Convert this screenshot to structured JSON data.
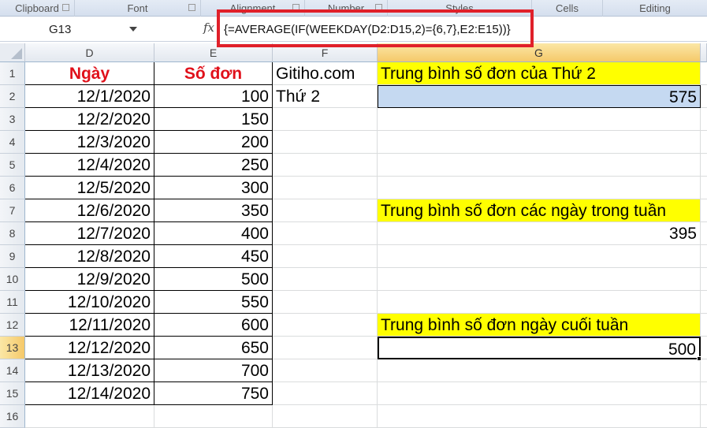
{
  "ribbon_groups": [
    "Clipboard",
    "Font",
    "Alignment",
    "Number",
    "Styles",
    "Cells",
    "Editing"
  ],
  "name_box": "G13",
  "formula": "{=AVERAGE(IF(WEEKDAY(D2:D15,2)={6,7},E2:E15))}",
  "columns": [
    "D",
    "E",
    "F",
    "G"
  ],
  "rows": [
    "1",
    "2",
    "3",
    "4",
    "5",
    "6",
    "7",
    "8",
    "9",
    "10",
    "11",
    "12",
    "13",
    "14",
    "15",
    "16"
  ],
  "headers": {
    "date": "Ngày",
    "orders": "Số đơn"
  },
  "data": [
    [
      "12/1/2020",
      "100"
    ],
    [
      "12/2/2020",
      "150"
    ],
    [
      "12/3/2020",
      "200"
    ],
    [
      "12/4/2020",
      "250"
    ],
    [
      "12/5/2020",
      "300"
    ],
    [
      "12/6/2020",
      "350"
    ],
    [
      "12/7/2020",
      "400"
    ],
    [
      "12/8/2020",
      "450"
    ],
    [
      "12/9/2020",
      "500"
    ],
    [
      "12/10/2020",
      "550"
    ],
    [
      "12/11/2020",
      "600"
    ],
    [
      "12/12/2020",
      "650"
    ],
    [
      "12/13/2020",
      "700"
    ],
    [
      "12/14/2020",
      "750"
    ]
  ],
  "F": {
    "f1": "Gitiho.com",
    "f2": "Thứ 2"
  },
  "G": {
    "g1": "Trung bình số đơn của Thứ 2",
    "g2": "575",
    "g7": "Trung bình số đơn các ngày trong tuần",
    "g8": "395",
    "g12": "Trung bình số đơn ngày cuối tuần",
    "g13": "500"
  }
}
